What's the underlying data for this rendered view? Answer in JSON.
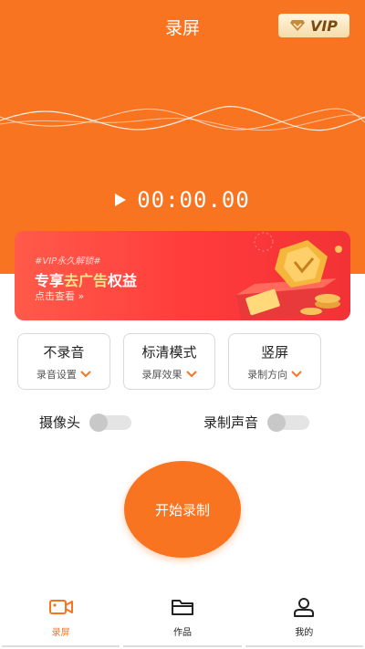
{
  "header": {
    "title": "录屏",
    "vip_label": "VIP"
  },
  "player": {
    "time": "00:00.00"
  },
  "banner": {
    "tag": "#VIP永久解锁#",
    "headline_prefix": "专享",
    "headline_highlight": "去广告",
    "headline_suffix": "权益",
    "link": "点击查看 »"
  },
  "settings": [
    {
      "title": "不录音",
      "sub": "录音设置"
    },
    {
      "title": "标清模式",
      "sub": "录屏效果"
    },
    {
      "title": "竖屏",
      "sub": "录制方向"
    }
  ],
  "toggles": {
    "camera": {
      "label": "摄像头",
      "on": false
    },
    "audio": {
      "label": "录制声音",
      "on": false
    }
  },
  "record_button": {
    "label": "开始录制"
  },
  "tabbar": [
    {
      "label": "录屏",
      "icon": "video-camera-icon",
      "active": true
    },
    {
      "label": "作品",
      "icon": "folder-icon",
      "active": false
    },
    {
      "label": "我的",
      "icon": "user-icon",
      "active": false
    }
  ],
  "colors": {
    "accent": "#F97420",
    "banner_red": "#FF3B3B",
    "gold": "#F5B73B"
  }
}
